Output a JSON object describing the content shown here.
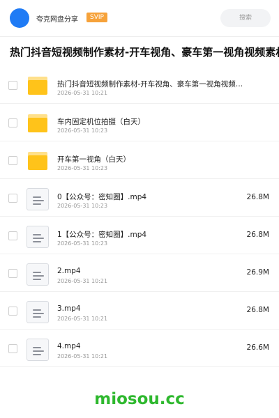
{
  "header": {
    "user_name": "夸克网盘分享",
    "badge": "SVIP",
    "search_label": "搜索",
    "avatar_color": "#1f7bf5",
    "badge_color": "#f6a23a"
  },
  "share": {
    "title": "热门抖音短视频制作素材-开车视角、豪车第一视角视频素材"
  },
  "files": [
    {
      "type": "folder",
      "icon": "folder-icon",
      "name": "热门抖音短视频制作素材-开车视角、豪车第一视角视频…",
      "date": "2026-05-31 10:21",
      "size": ""
    },
    {
      "type": "folder",
      "icon": "folder-icon",
      "name": "车内固定机位拍摄（白天）",
      "date": "2026-05-31 10:23",
      "size": ""
    },
    {
      "type": "folder",
      "icon": "folder-icon",
      "name": "开车第一视角（白天）",
      "date": "2026-05-31 10:23",
      "size": ""
    },
    {
      "type": "file",
      "icon": "document-icon",
      "name": "0【公众号：密知圈】.mp4",
      "date": "2026-05-31 10:23",
      "size": "26.8M"
    },
    {
      "type": "file",
      "icon": "document-icon",
      "name": "1【公众号：密知圈】.mp4",
      "date": "2026-05-31 10:23",
      "size": "26.8M"
    },
    {
      "type": "file",
      "icon": "document-icon",
      "name": "2.mp4",
      "date": "2026-05-31 10:21",
      "size": "26.9M"
    },
    {
      "type": "file",
      "icon": "document-icon",
      "name": "3.mp4",
      "date": "2026-05-31 10:21",
      "size": "26.8M"
    },
    {
      "type": "file",
      "icon": "document-icon",
      "name": "4.mp4",
      "date": "2026-05-31 10:21",
      "size": "26.6M"
    }
  ],
  "footer": {
    "brand": "miosou.cc",
    "brand_color": "#2eb82e"
  }
}
